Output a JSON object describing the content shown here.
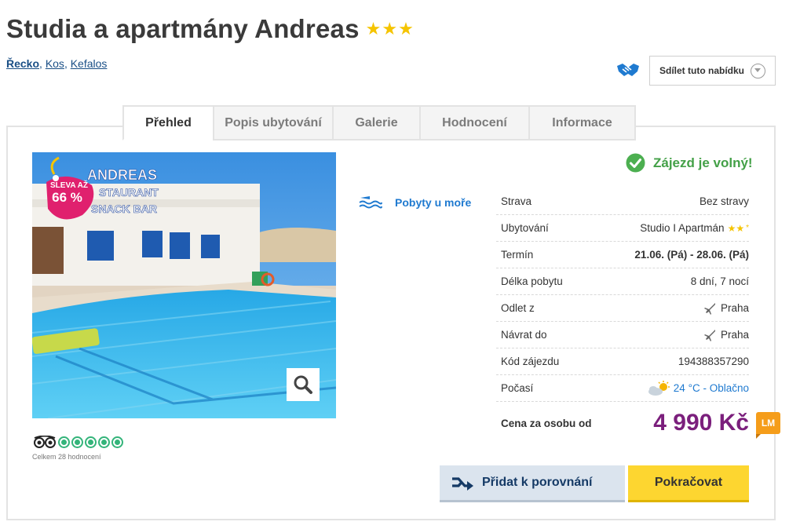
{
  "hotel": {
    "name": "Studia a apartmány Andreas",
    "stars": "★★★"
  },
  "breadcrumb": {
    "country": "Řecko",
    "island": "Kos",
    "town": "Kefalos",
    "sep1": ", ",
    "sep2": ", "
  },
  "share": {
    "label": "Sdílet tuto nabídku",
    "icon": "handshake-icon"
  },
  "tabs": [
    {
      "label": "Přehled",
      "active": true
    },
    {
      "label": "Popis ubytování"
    },
    {
      "label": "Galerie"
    },
    {
      "label": "Hodnocení"
    },
    {
      "label": "Informace"
    }
  ],
  "photo": {
    "sale_line1": "SLEVA AŽ",
    "sale_line2": "66 %",
    "sign_line1": "ANDREAS",
    "sign_line2": "STAURANT",
    "sign_line3": "SNACK BAR"
  },
  "tripadvisor": {
    "rating": 5,
    "count_text": "Celkem 28 hodnocení"
  },
  "sea_label": "Pobyty u moře",
  "availability": "Zájezd je volný!",
  "details": [
    {
      "label": "Strava",
      "value": "Bez stravy"
    },
    {
      "label": "Ubytování",
      "value": "Studio I Apartmán",
      "stars": "★★",
      "plus": "*"
    },
    {
      "label": "Termín",
      "value": "21.06. (Pá) - 28.06. (Pá)"
    },
    {
      "label": "Délka pobytu",
      "value": "8 dní, 7 nocí"
    },
    {
      "label": "Odlet z",
      "value": "Praha"
    },
    {
      "label": "Návrat do",
      "value": "Praha"
    },
    {
      "label": "Kód zájezdu",
      "value": "194388357290"
    },
    {
      "label": "Počasí",
      "value": "24 °C - Oblačno"
    }
  ],
  "price": {
    "label": "Cena za osobu od",
    "value": "4 990 Kč",
    "badge": "LM"
  },
  "buttons": {
    "compare": "Přidat k porovnání",
    "continue": "Pokračovat"
  },
  "colors": {
    "price": "#7b1f7c",
    "available": "#43a047",
    "link": "#1a4f86",
    "continue_bg": "#fdd630"
  }
}
